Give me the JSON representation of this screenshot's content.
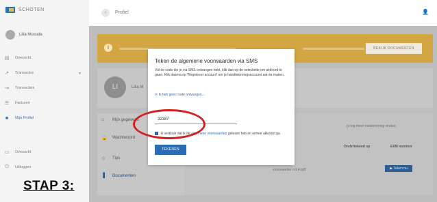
{
  "app": {
    "logo_text": "SCHOTEN"
  },
  "sidebar": {
    "user_name": "Lilia Mustafa",
    "items": [
      {
        "icon": "grid-icon",
        "glyph": "▤",
        "label": "Overzicht"
      },
      {
        "icon": "transactions-icon",
        "glyph": "↗",
        "label": "Transactes",
        "chevron": "▾"
      },
      {
        "icon": "transfer-icon",
        "glyph": "↝",
        "label": "Transacties"
      },
      {
        "icon": "invoice-icon",
        "glyph": "☰",
        "label": "Facturen"
      },
      {
        "icon": "account-icon",
        "glyph": "■",
        "label": "Mijn Profiel"
      }
    ],
    "bottom_items": [
      {
        "icon": "calendar-icon",
        "glyph": "▭",
        "label": "Overzicht"
      },
      {
        "icon": "logout-icon",
        "glyph": "⏻",
        "label": "Uitloggen"
      }
    ]
  },
  "topbar": {
    "back_glyph": "‹",
    "title": "Profiel",
    "user_glyph": "👤"
  },
  "banner": {
    "info_glyph": "i",
    "button_label": "BEKIJK DOCUMENTEN"
  },
  "profile_card": {
    "initials": "LI",
    "name": "Lilia M"
  },
  "tabs": [
    {
      "glyph": "⌂",
      "label": "Mijn gegevens"
    },
    {
      "glyph": "🔒",
      "label": "Wachtwoord"
    },
    {
      "glyph": "☆",
      "label": "Tips"
    },
    {
      "glyph": "▐",
      "label": "Documenten"
    }
  ],
  "panel": {
    "note": "g nog meer toestemming vinden.",
    "col_headers": [
      "Ondertekend op",
      "EXM nummer"
    ],
    "row_text": "voorwaarden v1.4.pdf",
    "button_label": "▶ Teken nu"
  },
  "modal": {
    "title": "Teken de algemene voorwaarden via SMS",
    "body": "Vul de code die je via SMS ontvangen hebt, klik dan op de selectietie om akkoord te gaan. Klik daarna op 'Registreer account' om je handtekeningsaccount aan te maken.",
    "resend_link": "⟳ Ik heb geen code ontvangen...",
    "code_value": "32387",
    "agree_prefix": "Ik verklaar dat ik de",
    "agree_link": "algemene voorwaarden",
    "agree_suffix": "gelezen heb en ermee akkoord ga",
    "submit_label": "TEKENEN"
  },
  "annotation": {
    "step_label": "STAP 3:",
    "highlight_color": "#d61f1f"
  }
}
